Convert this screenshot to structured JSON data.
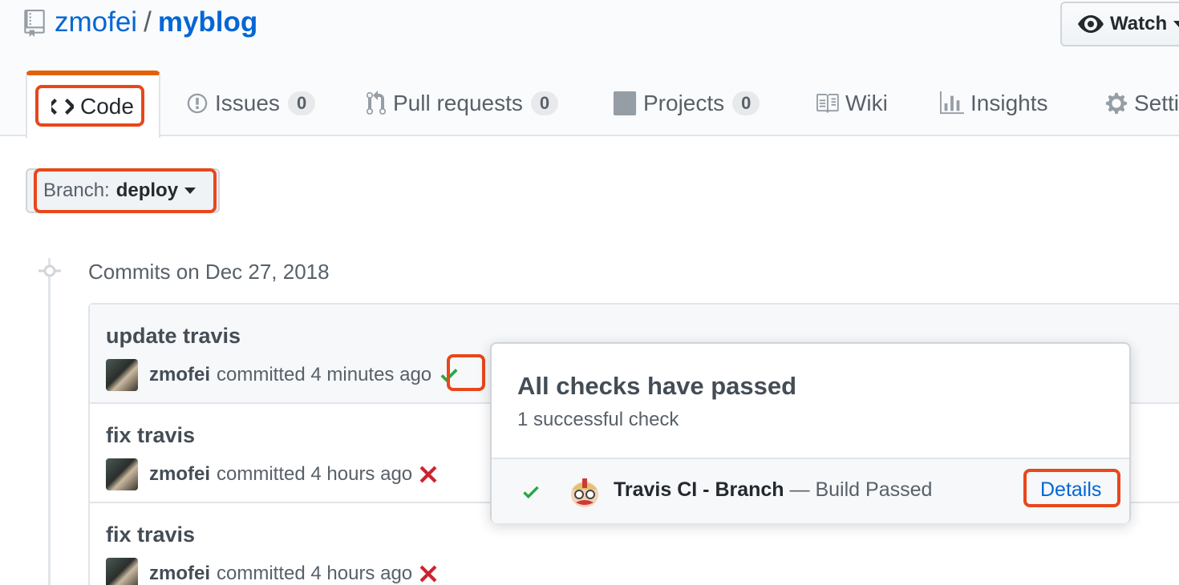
{
  "repo": {
    "owner": "zmofei",
    "separator": "/",
    "name": "myblog"
  },
  "watch": {
    "label": "Watch"
  },
  "tabs": [
    {
      "label": "Code"
    },
    {
      "label": "Issues",
      "count": "0"
    },
    {
      "label": "Pull requests",
      "count": "0"
    },
    {
      "label": "Projects",
      "count": "0"
    },
    {
      "label": "Wiki"
    },
    {
      "label": "Insights"
    },
    {
      "label": "Settings"
    }
  ],
  "branch": {
    "prefix": "Branch:",
    "name": "deploy"
  },
  "commits_heading": "Commits on Dec 27, 2018",
  "commits": [
    {
      "title": "update travis",
      "author": "zmofei",
      "committed": "committed 4 minutes ago",
      "status": "success"
    },
    {
      "title": "fix travis",
      "author": "zmofei",
      "committed": "committed 4 hours ago",
      "status": "failure"
    },
    {
      "title": "fix travis",
      "author": "zmofei",
      "committed": "committed 4 hours ago",
      "status": "failure"
    }
  ],
  "popover": {
    "title": "All checks have passed",
    "subtitle": "1 successful check",
    "check_name": "Travis CI - Branch",
    "check_desc": "— Build Passed",
    "details_label": "Details"
  },
  "colors": {
    "accent": "#e36209",
    "link": "#0366d6",
    "success": "#28a745",
    "failure": "#cb2431",
    "highlight": "#e8471c"
  }
}
